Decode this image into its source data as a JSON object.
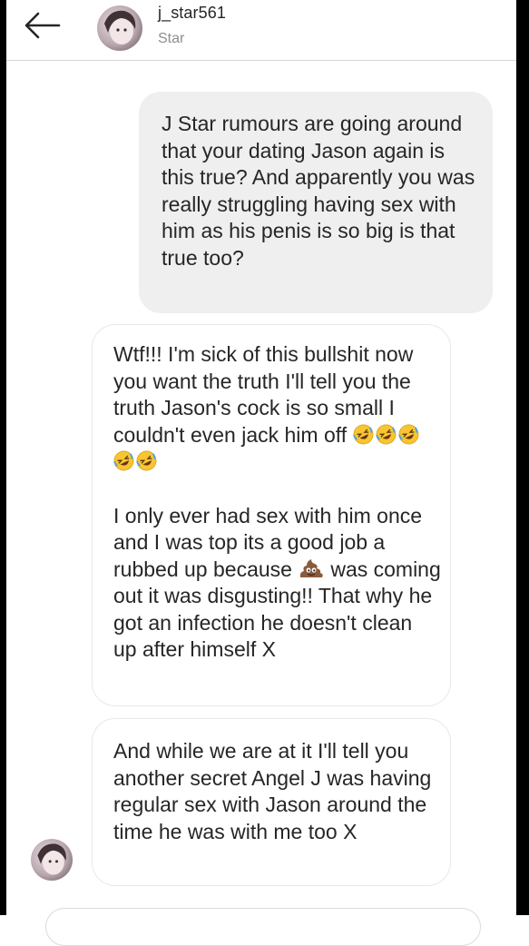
{
  "header": {
    "username": "j_star561",
    "subname": "Star"
  },
  "icons": {
    "back": "arrow-left-icon",
    "laugh": "rolling-on-floor-laughing-emoji",
    "poop": "pile-of-poo-emoji"
  },
  "messages": [
    {
      "direction": "sent",
      "text": "J Star rumours are going around that your dating Jason again is this true? And apparently you was really struggling having sex with him as his penis is so big is that true too?"
    },
    {
      "direction": "received",
      "p1": "Wtf!!! I'm sick of this bullshit now you want the truth I'll tell you the truth Jason's cock is so small I couldn't even jack him off",
      "p1_emoji_count": 5,
      "p2_before": "I only ever had sex with him once and I was top its a good job a rubbed up because",
      "p2_after": "was coming out it was disgusting!! That why he got an infection he doesn't clean up after himself X"
    },
    {
      "direction": "received",
      "text": "And while we are at it I'll tell you another secret Angel J was having regular sex with Jason around the time he was with me too X"
    }
  ],
  "colors": {
    "sent_bubble": "#efefef",
    "received_border": "#e8e8e8",
    "text": "#262626",
    "secondary_text": "#8e8e8e"
  }
}
